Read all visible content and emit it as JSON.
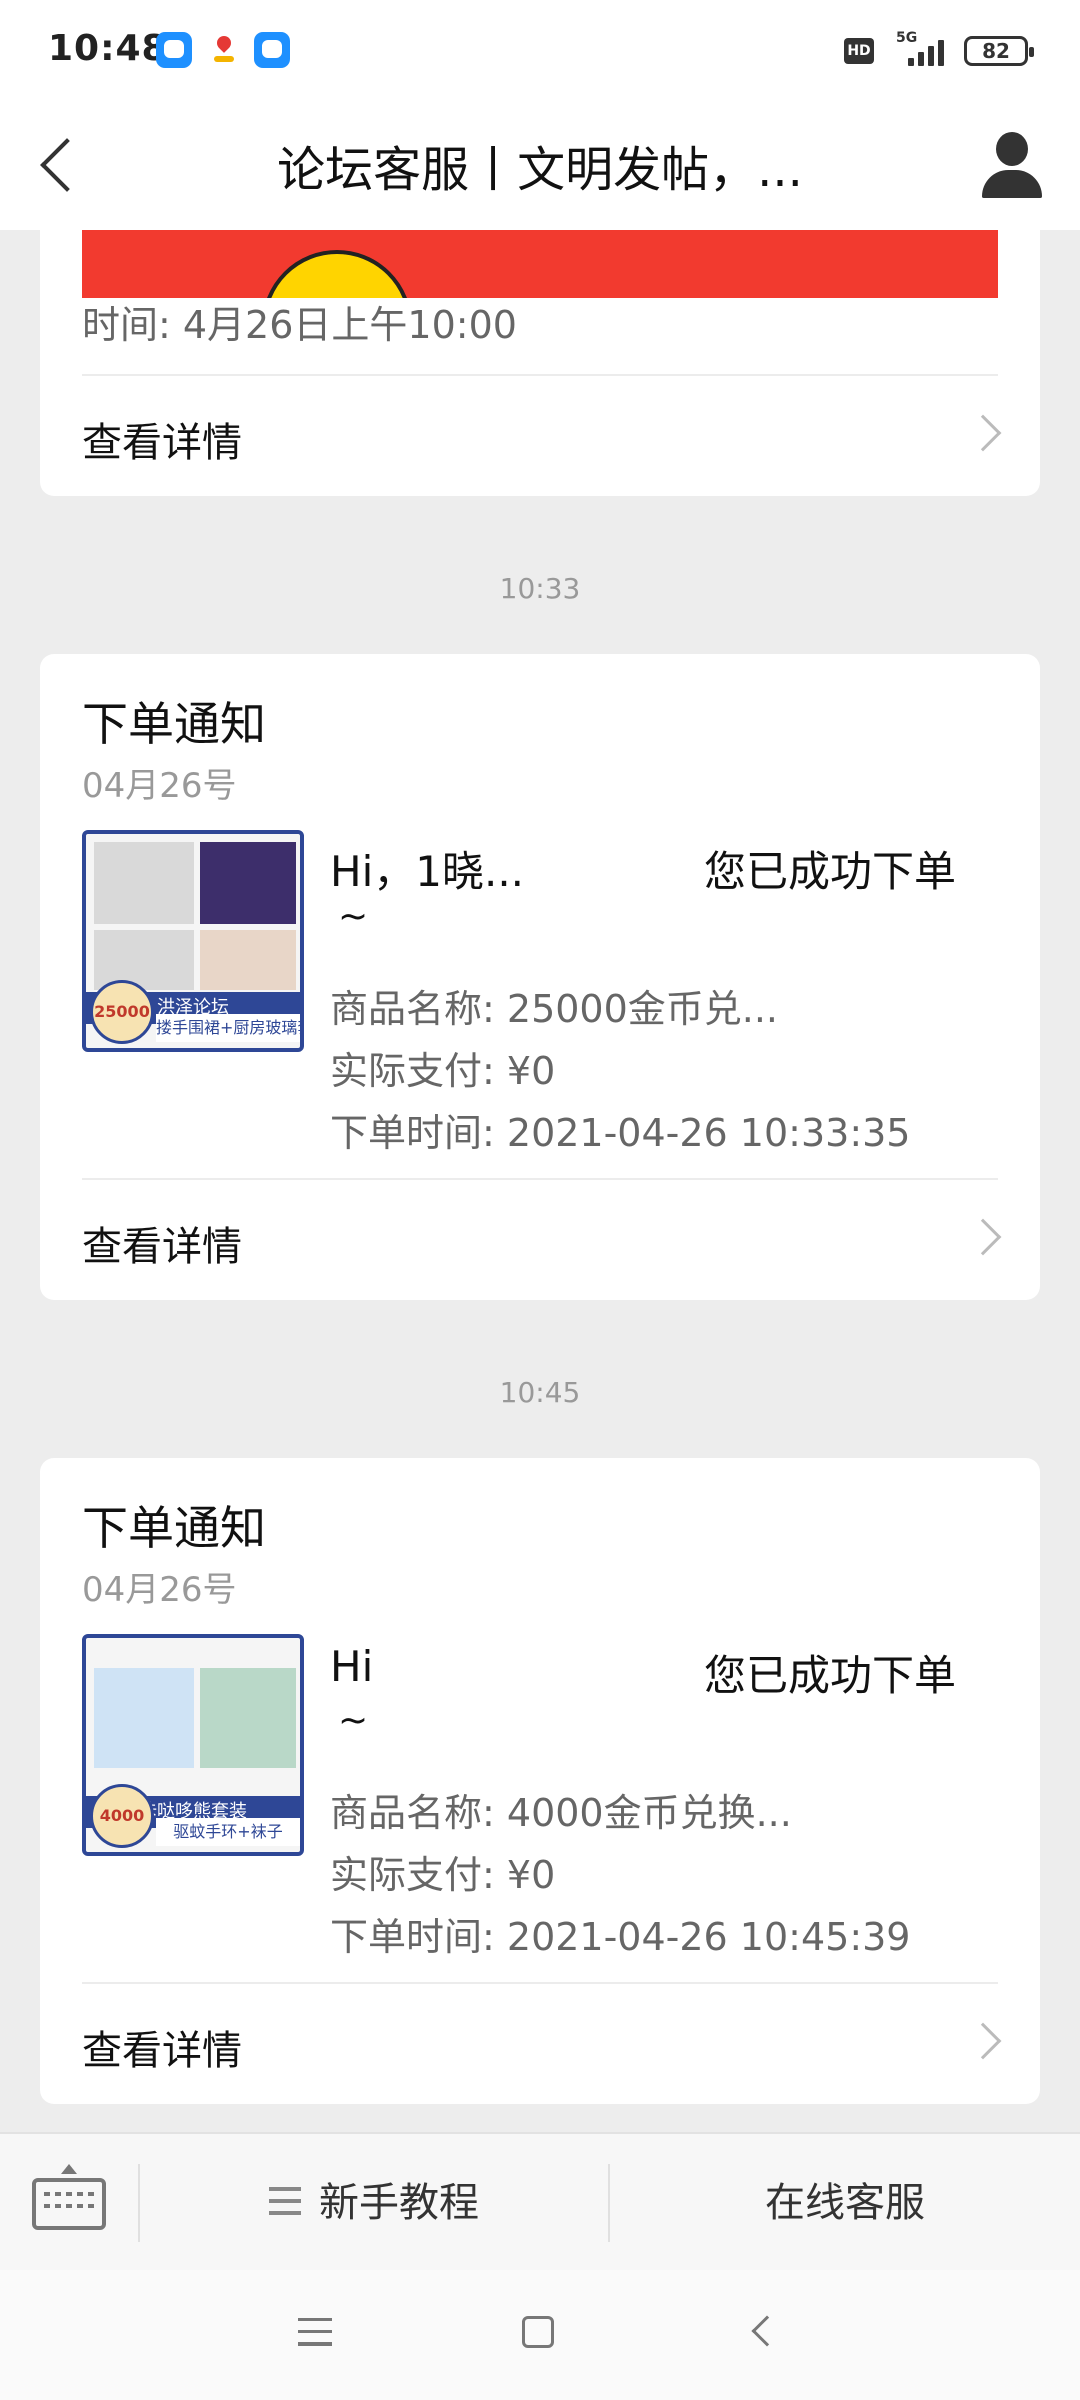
{
  "status_bar": {
    "time": "10:48",
    "hd": "HD",
    "network": "5G",
    "battery": "82"
  },
  "nav": {
    "title": "论坛客服丨文明发帖，..."
  },
  "top_card": {
    "event_time": "时间: 4月26日上午10:00",
    "detail_label": "查看详情"
  },
  "messages": [
    {
      "timestamp": "10:33",
      "title": "下单通知",
      "date": "04月26号",
      "greeting": "Hi，1晓...",
      "success": "您已成功下单",
      "tilde": "~",
      "product_label": "商品名称: ",
      "product": "25000金币兑...",
      "paid_label": "实际支付: ",
      "paid": "¥0",
      "order_time_label": "下单时间: ",
      "order_time": "2021-04-26 10:33:35",
      "thumb_band": "洪泽论坛",
      "thumb_coin": "25000",
      "thumb_caption": "搂手围裙+厨房玻璃套装",
      "detail_label": "查看详情"
    },
    {
      "timestamp": "10:45",
      "title": "下单通知",
      "date": "04月26号",
      "greeting": "Hi",
      "success": "您已成功下单",
      "tilde": "~",
      "product_label": "商品名称: ",
      "product": "4000金币兑换...",
      "paid_label": "实际支付: ",
      "paid": "¥0",
      "order_time_label": "下单时间: ",
      "order_time": "2021-04-26 10:45:39",
      "thumb_band": "咔哒哆熊套装",
      "thumb_coin": "4000",
      "thumb_caption": "驱蚊手环+袜子",
      "detail_label": "查看详情"
    }
  ],
  "toolbar": {
    "tutorial": "新手教程",
    "service": "在线客服"
  },
  "colors": {
    "accent_blue": "#2e4796",
    "banner_red": "#f23a2f",
    "background": "#ededed"
  }
}
